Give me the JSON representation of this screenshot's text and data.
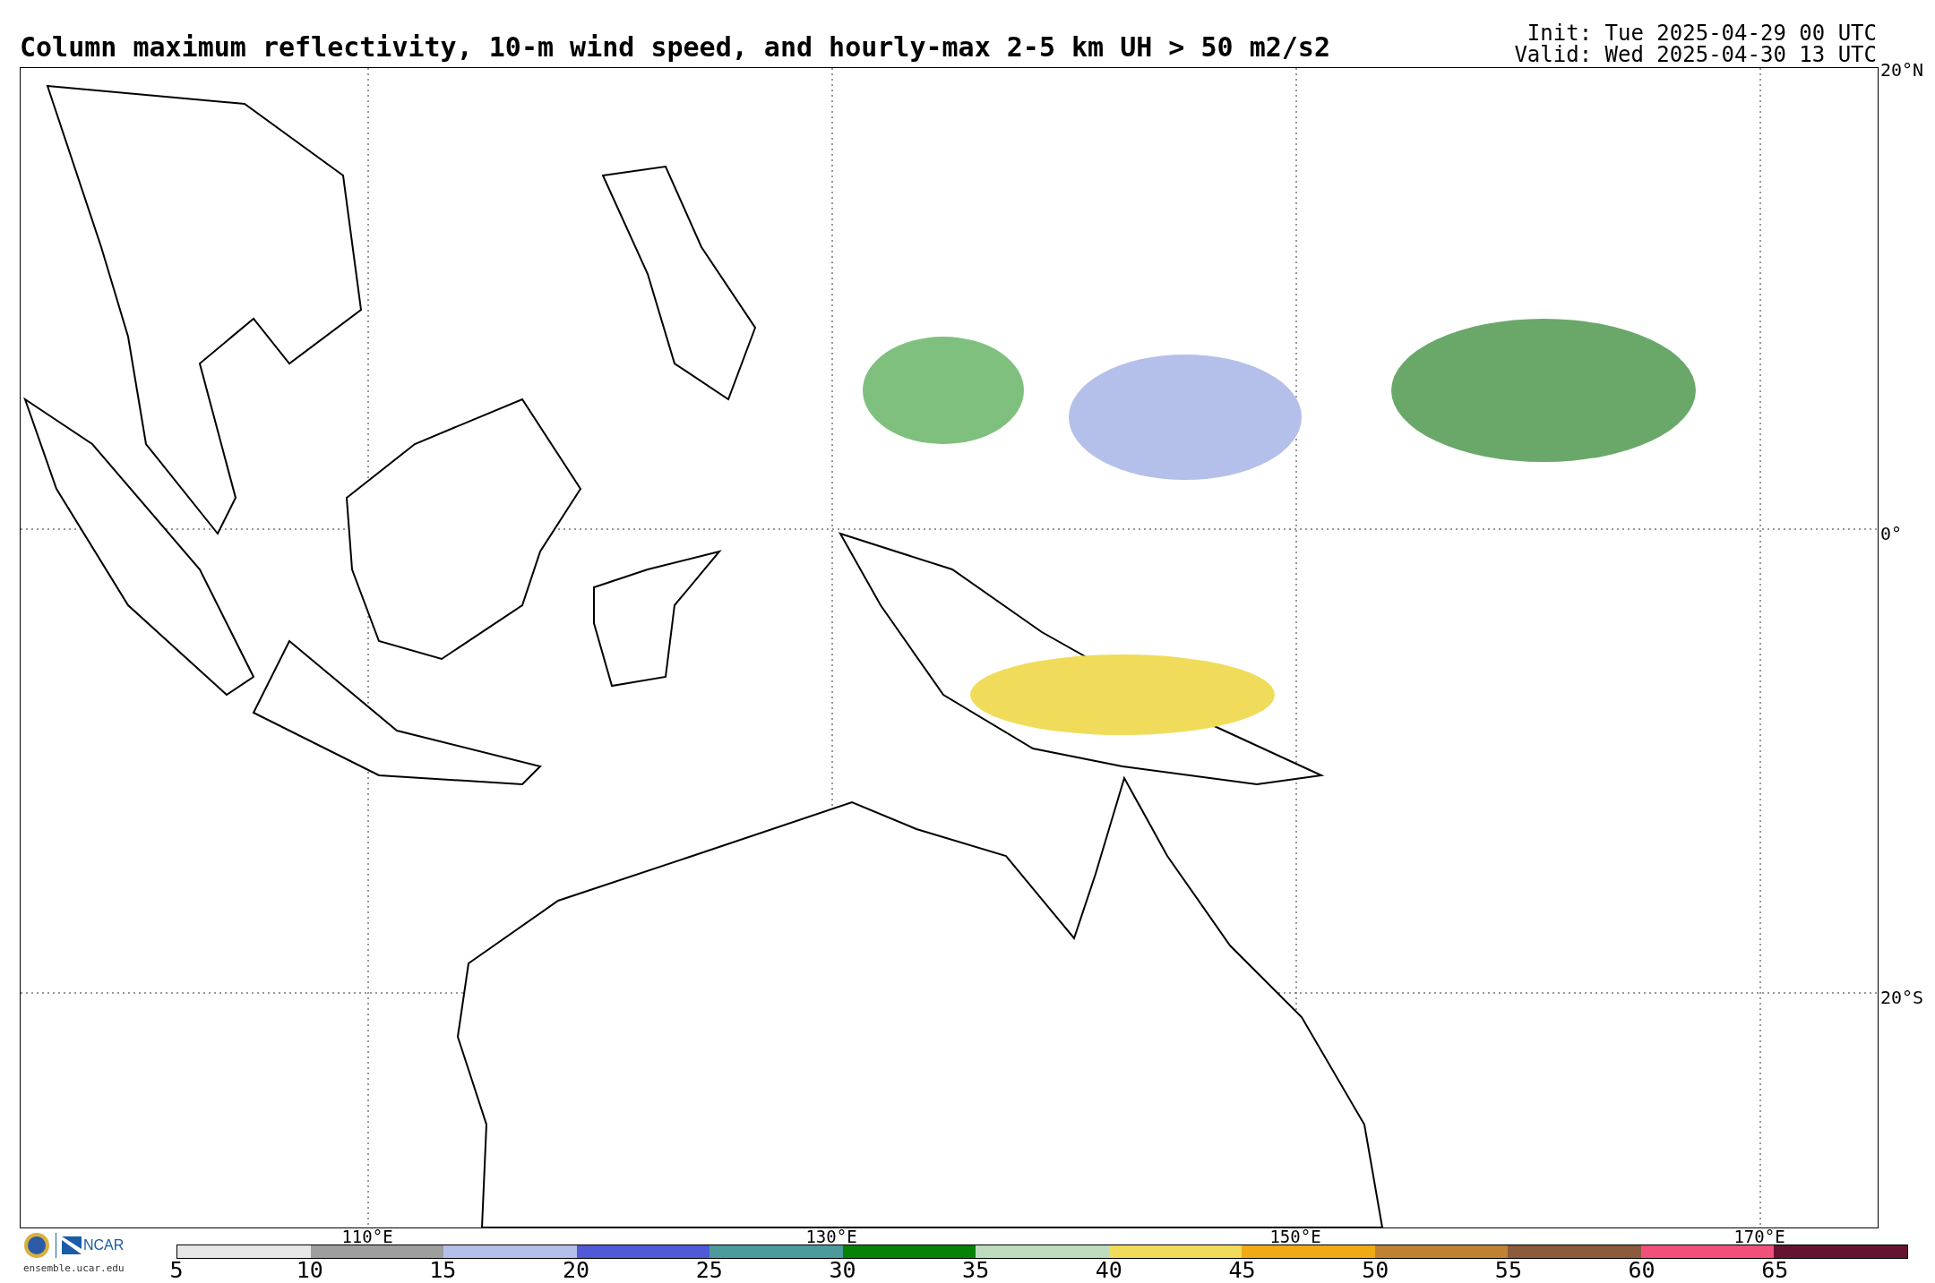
{
  "title": "Column maximum reflectivity, 10-m wind speed, and hourly-max 2-5 km UH > 50 m2/s2",
  "init": "Init: Tue 2025-04-29 00 UTC",
  "valid": "Valid: Wed 2025-04-30 13 UTC",
  "map": {
    "lat_labels": [
      "20°N",
      "0°",
      "20°S"
    ],
    "lon_labels": [
      "110°E",
      "130°E",
      "150°E",
      "170°E"
    ]
  },
  "footer": {
    "logo_text": "NCAR",
    "url": "ensemble.ucar.edu"
  },
  "colorbar": {
    "segments": [
      {
        "color": "#e6e6e6"
      },
      {
        "color": "#9e9e9e"
      },
      {
        "color": "#b4c0ea"
      },
      {
        "color": "#505ad6"
      },
      {
        "color": "#4c9a9c"
      },
      {
        "color": "#068206"
      },
      {
        "color": "#bedcbe"
      },
      {
        "color": "#f0dc5a"
      },
      {
        "color": "#f0aa14"
      },
      {
        "color": "#be8232"
      },
      {
        "color": "#8c5a3c"
      },
      {
        "color": "#f0507a"
      },
      {
        "color": "#641432"
      }
    ],
    "tick_labels": [
      "5",
      "10",
      "15",
      "20",
      "25",
      "30",
      "35",
      "40",
      "45",
      "50",
      "55",
      "60",
      "65"
    ]
  }
}
